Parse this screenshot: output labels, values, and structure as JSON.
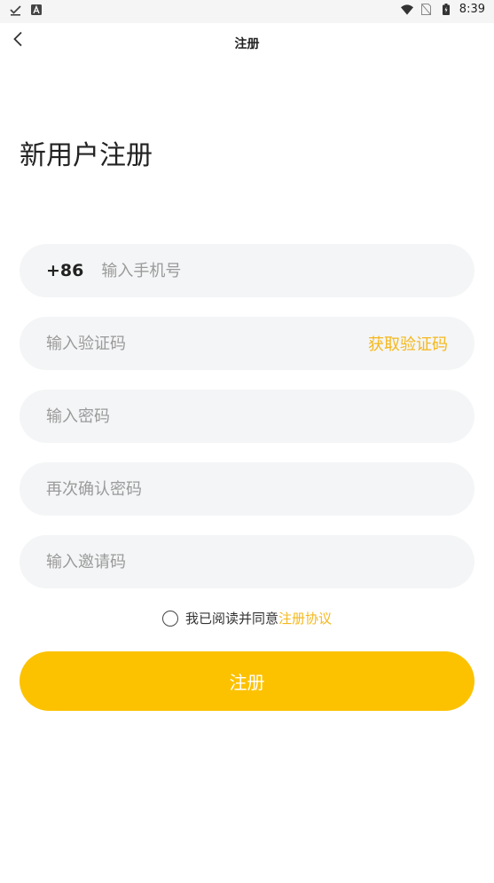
{
  "status_bar": {
    "time": "8:39",
    "left_icons": [
      "download-done-icon",
      "font-icon"
    ],
    "right_icons": [
      "wifi-icon",
      "no-sim-icon",
      "battery-icon"
    ]
  },
  "header": {
    "title": "注册",
    "back_icon": "chevron-left-icon"
  },
  "page_title": "新用户注册",
  "form": {
    "country_code": "+86",
    "phone_placeholder": "输入手机号",
    "code_placeholder": "输入验证码",
    "get_code_label": "获取验证码",
    "password_placeholder": "输入密码",
    "confirm_password_placeholder": "再次确认密码",
    "invite_code_placeholder": "输入邀请码"
  },
  "agreement": {
    "text": "我已阅读并同意",
    "link": "注册协议"
  },
  "register_button": "注册",
  "colors": {
    "accent": "#fcc200",
    "link": "#f5b81c",
    "field_bg": "#f4f5f6"
  }
}
